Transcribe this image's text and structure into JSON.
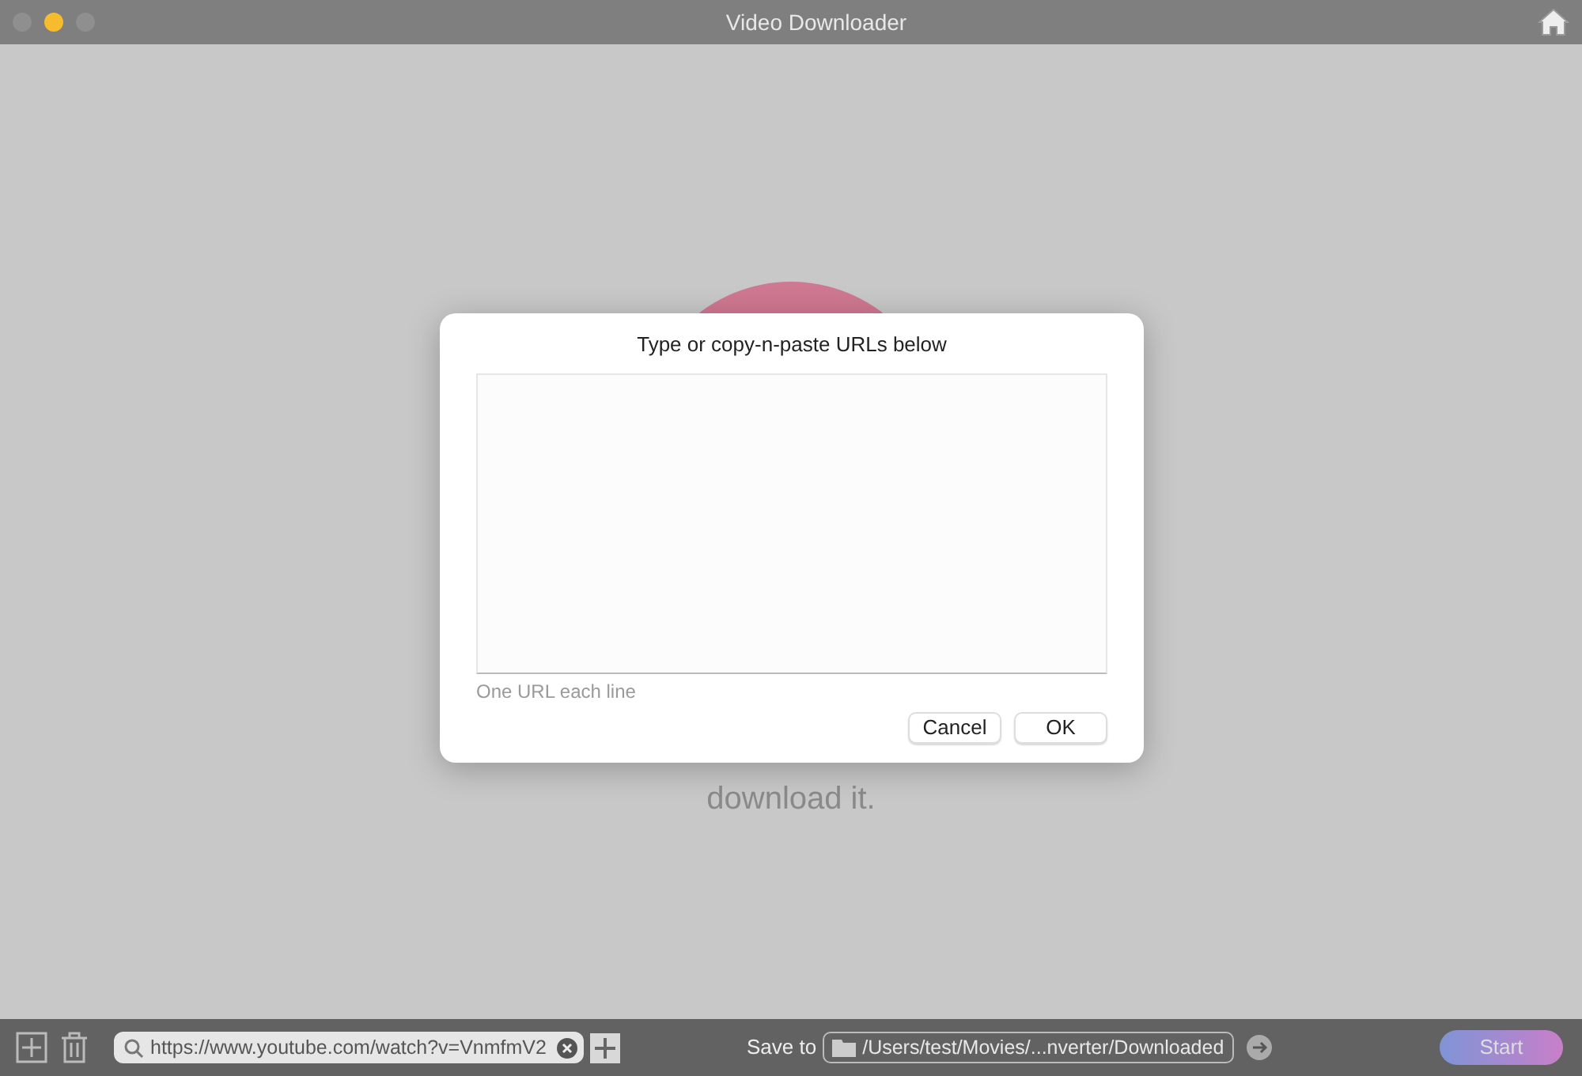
{
  "window": {
    "title": "Video Downloader"
  },
  "background": {
    "text": "download it."
  },
  "dialog": {
    "title": "Type or copy-n-paste URLs below",
    "hint": "One URL each line",
    "buttons": [
      "Cancel",
      "OK"
    ]
  },
  "bottom_bar": {
    "url_field": {
      "value": "https://www.youtube.com/watch?v=VnmfmV2"
    },
    "save_label": "Save to",
    "save_path": "/Users/test/Movies/...nverter/Downloaded",
    "start_button": {
      "label": "Start",
      "disabled": true
    }
  }
}
